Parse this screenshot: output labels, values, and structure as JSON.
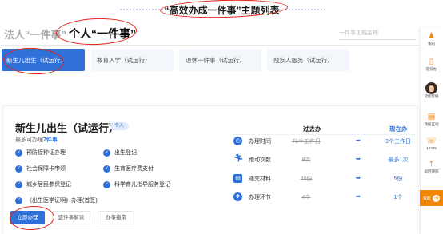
{
  "page_title": "“高效办成一件事”主题列表",
  "tabs": {
    "faren": "法人“一件事”",
    "geren": "个人“一件事”"
  },
  "search": {
    "placeholder": "一件事主题名称"
  },
  "categories": [
    {
      "label": "新生儿出生（试运行）",
      "active": true
    },
    {
      "label": "教育入学（试运行）",
      "active": false
    },
    {
      "label": "退休一件事（试运行）",
      "active": false
    },
    {
      "label": "残疾人服务（试运行）",
      "active": false
    }
  ],
  "service": {
    "title": "新生儿出生（试运行）",
    "badge": "个人",
    "subtitle_prefix": "最多可办理",
    "subtitle_count": "7件事",
    "items": [
      "预防接种证办理",
      "出生登记",
      "社会保障卡申领",
      "生育医疗费支付",
      "城乡居民参保登记",
      "科学育儿指导服务登记",
      "《出生医学证明》办理(首签)"
    ],
    "buttons": {
      "primary": "立即办理",
      "guide": "这件事解读",
      "handbook": "办事指南"
    }
  },
  "comparison": {
    "before_label": "过去办",
    "after_label": "现在办",
    "rows": [
      {
        "label": "办理时间",
        "icon": "clock-icon",
        "before": "71个工作日",
        "after": "3个工作日"
      },
      {
        "label": "跑动次数",
        "icon": "runner-icon",
        "before": "8次",
        "after": "最多1次"
      },
      {
        "label": "递交材料",
        "icon": "document-icon",
        "before": "40份",
        "after": "5份"
      },
      {
        "label": "办理环节",
        "icon": "steps-icon",
        "before": "4个",
        "after": "1个"
      }
    ],
    "arrow": "➡"
  },
  "rail": [
    {
      "label": "我的",
      "glyph": "♟",
      "icon": "user-icon"
    },
    {
      "label": "官快办",
      "glyph": "▯",
      "icon": "phone-icon"
    },
    {
      "label": "智能客服",
      "glyph": "",
      "icon": "avatar-icon"
    },
    {
      "label": "政民互动",
      "glyph": "▤",
      "icon": "message-icon"
    },
    {
      "label": "12345",
      "glyph": "☏",
      "icon": "hotline-icon"
    },
    {
      "label": "返回顶部",
      "glyph": "⤒",
      "icon": "back-to-top-icon"
    }
  ],
  "rail_bottom": {
    "label": "收起",
    "glyph": "➔"
  },
  "colors": {
    "accent": "#2f71d8",
    "annotation": "#e2231a",
    "rail_accent": "#f0860a"
  }
}
